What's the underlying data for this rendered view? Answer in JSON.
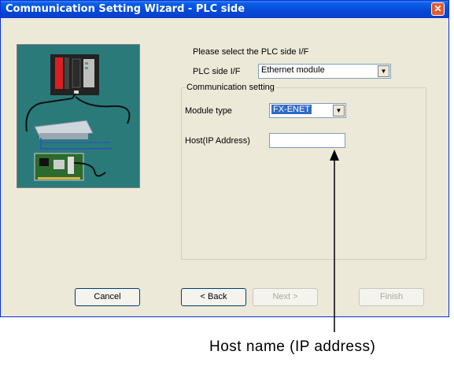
{
  "window": {
    "title": "Communication Setting Wizard - PLC side",
    "close_glyph": "✕"
  },
  "prompt": "Please select the PLC side I/F",
  "plc_side": {
    "label": "PLC side I/F",
    "value": "Ethernet module"
  },
  "communication_setting": {
    "legend": "Communication setting",
    "module_type_label": "Module type",
    "module_type_value": "FX-ENET",
    "host_label": "Host(IP Address)",
    "host_value": ""
  },
  "buttons": {
    "cancel": "Cancel",
    "back": "< Back",
    "next": "Next >",
    "finish": "Finish"
  },
  "annotation": "Host name (IP address)",
  "colors": {
    "titlebar": "#0548d8",
    "window_bg": "#ece9d8",
    "illustration_bg": "#2a7a7a",
    "selected_highlight": "#316ac5"
  }
}
